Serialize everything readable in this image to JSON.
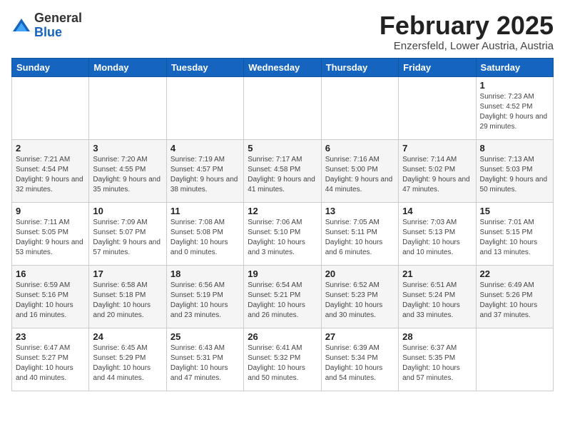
{
  "logo": {
    "general": "General",
    "blue": "Blue"
  },
  "title": "February 2025",
  "subtitle": "Enzersfeld, Lower Austria, Austria",
  "weekdays": [
    "Sunday",
    "Monday",
    "Tuesday",
    "Wednesday",
    "Thursday",
    "Friday",
    "Saturday"
  ],
  "weeks": [
    [
      {
        "day": "",
        "info": ""
      },
      {
        "day": "",
        "info": ""
      },
      {
        "day": "",
        "info": ""
      },
      {
        "day": "",
        "info": ""
      },
      {
        "day": "",
        "info": ""
      },
      {
        "day": "",
        "info": ""
      },
      {
        "day": "1",
        "info": "Sunrise: 7:23 AM\nSunset: 4:52 PM\nDaylight: 9 hours and 29 minutes."
      }
    ],
    [
      {
        "day": "2",
        "info": "Sunrise: 7:21 AM\nSunset: 4:54 PM\nDaylight: 9 hours and 32 minutes."
      },
      {
        "day": "3",
        "info": "Sunrise: 7:20 AM\nSunset: 4:55 PM\nDaylight: 9 hours and 35 minutes."
      },
      {
        "day": "4",
        "info": "Sunrise: 7:19 AM\nSunset: 4:57 PM\nDaylight: 9 hours and 38 minutes."
      },
      {
        "day": "5",
        "info": "Sunrise: 7:17 AM\nSunset: 4:58 PM\nDaylight: 9 hours and 41 minutes."
      },
      {
        "day": "6",
        "info": "Sunrise: 7:16 AM\nSunset: 5:00 PM\nDaylight: 9 hours and 44 minutes."
      },
      {
        "day": "7",
        "info": "Sunrise: 7:14 AM\nSunset: 5:02 PM\nDaylight: 9 hours and 47 minutes."
      },
      {
        "day": "8",
        "info": "Sunrise: 7:13 AM\nSunset: 5:03 PM\nDaylight: 9 hours and 50 minutes."
      }
    ],
    [
      {
        "day": "9",
        "info": "Sunrise: 7:11 AM\nSunset: 5:05 PM\nDaylight: 9 hours and 53 minutes."
      },
      {
        "day": "10",
        "info": "Sunrise: 7:09 AM\nSunset: 5:07 PM\nDaylight: 9 hours and 57 minutes."
      },
      {
        "day": "11",
        "info": "Sunrise: 7:08 AM\nSunset: 5:08 PM\nDaylight: 10 hours and 0 minutes."
      },
      {
        "day": "12",
        "info": "Sunrise: 7:06 AM\nSunset: 5:10 PM\nDaylight: 10 hours and 3 minutes."
      },
      {
        "day": "13",
        "info": "Sunrise: 7:05 AM\nSunset: 5:11 PM\nDaylight: 10 hours and 6 minutes."
      },
      {
        "day": "14",
        "info": "Sunrise: 7:03 AM\nSunset: 5:13 PM\nDaylight: 10 hours and 10 minutes."
      },
      {
        "day": "15",
        "info": "Sunrise: 7:01 AM\nSunset: 5:15 PM\nDaylight: 10 hours and 13 minutes."
      }
    ],
    [
      {
        "day": "16",
        "info": "Sunrise: 6:59 AM\nSunset: 5:16 PM\nDaylight: 10 hours and 16 minutes."
      },
      {
        "day": "17",
        "info": "Sunrise: 6:58 AM\nSunset: 5:18 PM\nDaylight: 10 hours and 20 minutes."
      },
      {
        "day": "18",
        "info": "Sunrise: 6:56 AM\nSunset: 5:19 PM\nDaylight: 10 hours and 23 minutes."
      },
      {
        "day": "19",
        "info": "Sunrise: 6:54 AM\nSunset: 5:21 PM\nDaylight: 10 hours and 26 minutes."
      },
      {
        "day": "20",
        "info": "Sunrise: 6:52 AM\nSunset: 5:23 PM\nDaylight: 10 hours and 30 minutes."
      },
      {
        "day": "21",
        "info": "Sunrise: 6:51 AM\nSunset: 5:24 PM\nDaylight: 10 hours and 33 minutes."
      },
      {
        "day": "22",
        "info": "Sunrise: 6:49 AM\nSunset: 5:26 PM\nDaylight: 10 hours and 37 minutes."
      }
    ],
    [
      {
        "day": "23",
        "info": "Sunrise: 6:47 AM\nSunset: 5:27 PM\nDaylight: 10 hours and 40 minutes."
      },
      {
        "day": "24",
        "info": "Sunrise: 6:45 AM\nSunset: 5:29 PM\nDaylight: 10 hours and 44 minutes."
      },
      {
        "day": "25",
        "info": "Sunrise: 6:43 AM\nSunset: 5:31 PM\nDaylight: 10 hours and 47 minutes."
      },
      {
        "day": "26",
        "info": "Sunrise: 6:41 AM\nSunset: 5:32 PM\nDaylight: 10 hours and 50 minutes."
      },
      {
        "day": "27",
        "info": "Sunrise: 6:39 AM\nSunset: 5:34 PM\nDaylight: 10 hours and 54 minutes."
      },
      {
        "day": "28",
        "info": "Sunrise: 6:37 AM\nSunset: 5:35 PM\nDaylight: 10 hours and 57 minutes."
      },
      {
        "day": "",
        "info": ""
      }
    ]
  ]
}
